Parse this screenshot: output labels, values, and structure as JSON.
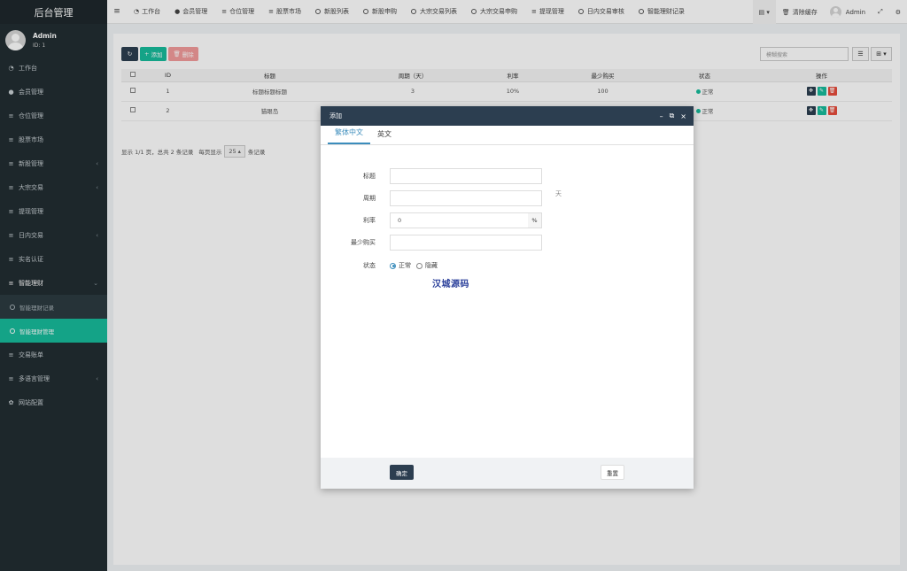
{
  "app_title": "后台管理",
  "user": {
    "name": "Admin",
    "id": "ID: 1"
  },
  "sidebar": {
    "items": [
      {
        "label": "工作台",
        "icon": "dashboard-icon"
      },
      {
        "label": "会员管理",
        "icon": "user-icon"
      },
      {
        "label": "仓位管理",
        "icon": "list-icon"
      },
      {
        "label": "股票市场",
        "icon": "list-icon"
      },
      {
        "label": "新股管理",
        "icon": "list-icon"
      },
      {
        "label": "大宗交易",
        "icon": "list-icon"
      },
      {
        "label": "提现管理",
        "icon": "list-icon"
      },
      {
        "label": "日内交易",
        "icon": "list-icon"
      },
      {
        "label": "实名认证",
        "icon": "list-icon"
      },
      {
        "label": "智能理财",
        "icon": "list-icon"
      },
      {
        "label": "交易账单",
        "icon": "list-icon"
      },
      {
        "label": "多语言管理",
        "icon": "list-icon"
      },
      {
        "label": "网站配置",
        "icon": "gear-icon"
      }
    ],
    "sub_items": [
      {
        "label": "智能理财记录"
      },
      {
        "label": "智能理财管理"
      }
    ]
  },
  "topnav": {
    "items": [
      {
        "label": "工作台"
      },
      {
        "label": "会员管理"
      },
      {
        "label": "仓位管理"
      },
      {
        "label": "股票市场"
      },
      {
        "label": "新股列表"
      },
      {
        "label": "新股申购"
      },
      {
        "label": "大宗交易列表"
      },
      {
        "label": "大宗交易申购"
      },
      {
        "label": "提现管理"
      },
      {
        "label": "日内交易审核"
      },
      {
        "label": "智能理财记录"
      }
    ],
    "clear_cache": "清除缓存",
    "admin": "Admin"
  },
  "toolbar": {
    "add_label": "添加",
    "delete_label": "删除",
    "search_placeholder": "模糊搜索"
  },
  "table": {
    "headers": [
      "ID",
      "标题",
      "周期（天）",
      "利率",
      "最少购买",
      "状态",
      "操作"
    ],
    "rows": [
      {
        "id": "1",
        "title": "标题标题标题",
        "period": "3",
        "rate": "10%",
        "min": "100",
        "status": "正常"
      },
      {
        "id": "2",
        "title": "猫眼岛",
        "period": "",
        "rate": "",
        "min": "",
        "status": "正常"
      }
    ]
  },
  "pagination": {
    "summary": "显示 1/1 页，总共 2 条记录",
    "per_page_label": "每页显示",
    "per_page_value": "25",
    "records_label": "条记录"
  },
  "modal": {
    "title": "添加",
    "tabs": [
      "繁体中文",
      "英文"
    ],
    "fields": {
      "title_label": "标题",
      "period_label": "周期",
      "period_suffix": "天",
      "rate_label": "利率",
      "rate_value": "0",
      "rate_addon": "%",
      "min_label": "最少购买",
      "status_label": "状态",
      "status_normal": "正常",
      "status_hidden": "隐藏"
    },
    "watermark": "汉城源码",
    "ok_label": "确定",
    "reset_label": "重置"
  },
  "colors": {
    "sidebar_bg": "#222d32",
    "accent": "#18bc9c",
    "header_dark": "#2c3e50",
    "danger": "#e74c3c"
  }
}
